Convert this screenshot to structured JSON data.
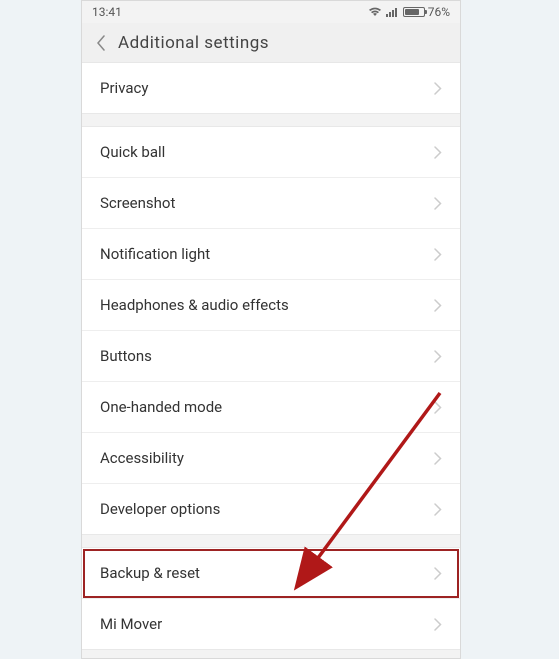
{
  "status_bar": {
    "time": "13:41",
    "battery_percent": "76%"
  },
  "header": {
    "title": "Additional  settings"
  },
  "groups": [
    {
      "items": [
        {
          "id": "privacy",
          "label": "Privacy"
        }
      ]
    },
    {
      "items": [
        {
          "id": "quick-ball",
          "label": "Quick ball"
        },
        {
          "id": "screenshot",
          "label": "Screenshot"
        },
        {
          "id": "notification-light",
          "label": "Notification light"
        },
        {
          "id": "headphones",
          "label": "Headphones & audio effects"
        },
        {
          "id": "buttons",
          "label": "Buttons"
        },
        {
          "id": "one-handed",
          "label": "One-handed mode"
        },
        {
          "id": "accessibility",
          "label": "Accessibility"
        },
        {
          "id": "developer",
          "label": "Developer options"
        }
      ]
    },
    {
      "items": [
        {
          "id": "backup-reset",
          "label": "Backup & reset",
          "highlighted": true
        },
        {
          "id": "mi-mover",
          "label": "Mi Mover"
        }
      ]
    }
  ]
}
